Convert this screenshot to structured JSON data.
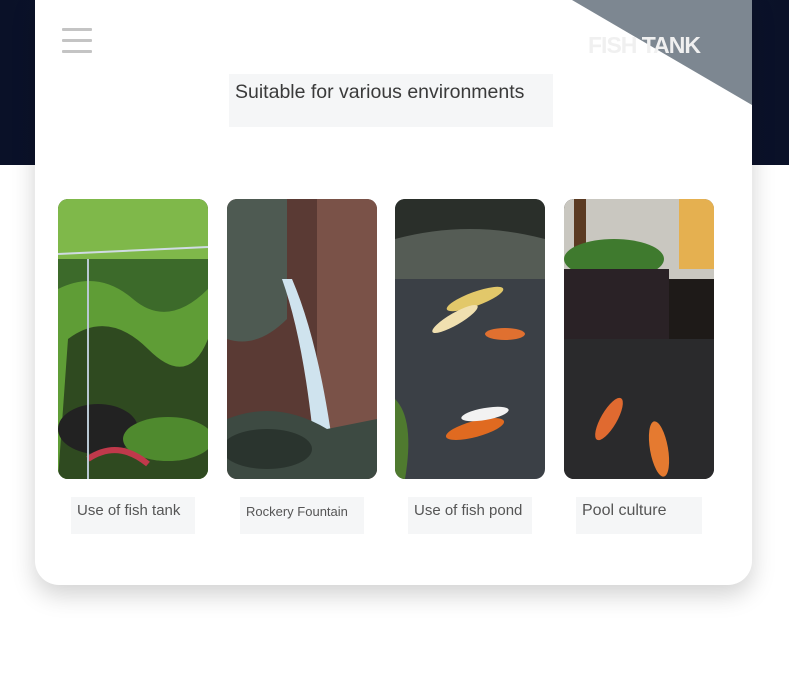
{
  "header": {
    "brand": "FISH TANK",
    "menu_icon": "hamburger-menu-icon"
  },
  "main": {
    "headline": "Suitable for various environments",
    "environments": [
      {
        "label": "Use of fish tank"
      },
      {
        "label": "Rockery Fountain"
      },
      {
        "label": "Use of fish pond"
      },
      {
        "label": "Pool culture"
      }
    ]
  },
  "colors": {
    "band": "#0a1128",
    "card": "#ffffff",
    "caption_bg": "#f5f6f7",
    "text": "#3a3a3a"
  }
}
